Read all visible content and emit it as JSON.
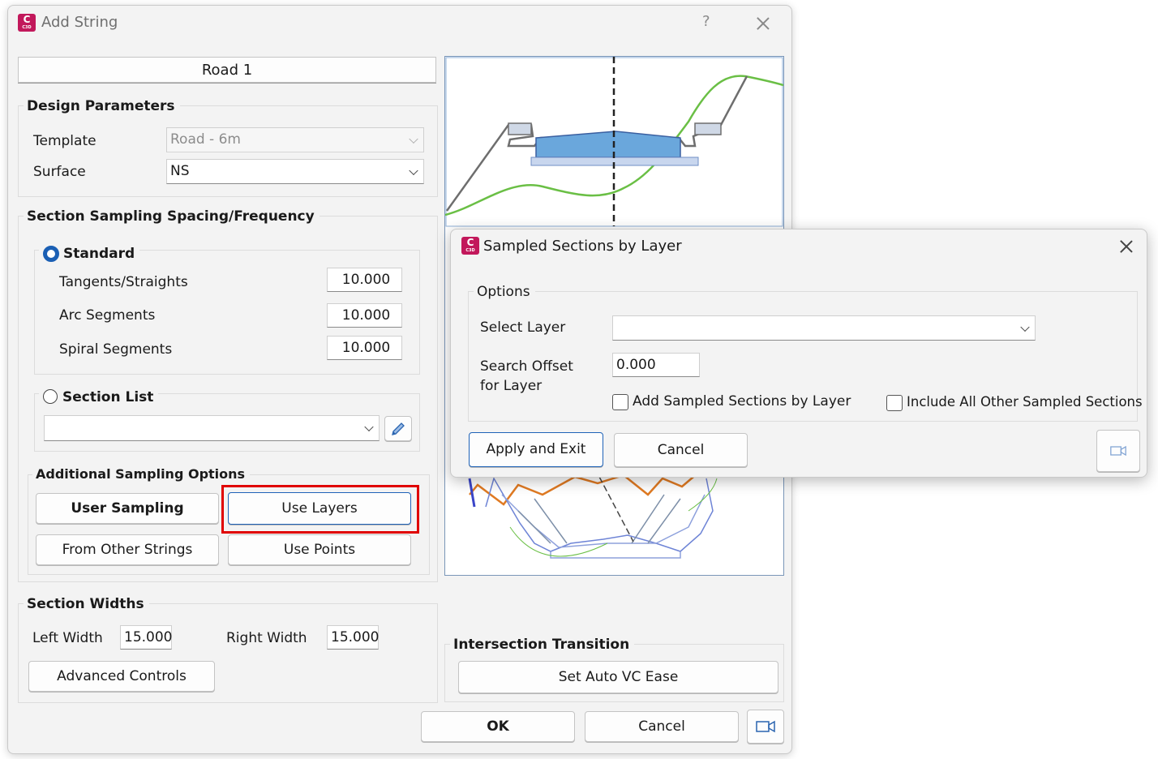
{
  "main_dialog": {
    "title": "Add String",
    "help": "?",
    "road_header": "Road 1",
    "design_parameters": {
      "label": "Design Parameters",
      "template_label": "Template",
      "template_value": "Road - 6m",
      "surface_label": "Surface",
      "surface_value": "NS"
    },
    "sampling": {
      "label": "Section Sampling Spacing/Frequency",
      "standard_label": "Standard",
      "tangents_label": "Tangents/Straights",
      "tangents_value": "10.000",
      "arc_label": "Arc Segments",
      "arc_value": "10.000",
      "spiral_label": "Spiral Segments",
      "spiral_value": "10.000",
      "section_list_label": "Section List",
      "section_list_value": ""
    },
    "additional": {
      "label": "Additional Sampling Options",
      "user_sampling": "User Sampling",
      "use_layers": "Use Layers",
      "from_other_strings": "From Other Strings",
      "use_points": "Use Points"
    },
    "widths": {
      "label": "Section Widths",
      "left_label": "Left Width",
      "left_value": "15.000",
      "right_label": "Right Width",
      "right_value": "15.000",
      "advanced": "Advanced Controls"
    },
    "intersection": {
      "label": "Intersection Transition",
      "set_auto": "Set Auto VC Ease"
    },
    "ok": "OK",
    "cancel": "Cancel"
  },
  "overlay_dialog": {
    "title": "Sampled Sections by Layer",
    "options_label": "Options",
    "select_layer_label": "Select Layer",
    "select_layer_value": "",
    "search_offset_label_1": "Search Offset",
    "search_offset_label_2": "for Layer",
    "search_offset_value": "0.000",
    "add_sampled_label": "Add Sampled Sections by Layer",
    "include_all_label": "Include All Other Sampled Sections",
    "apply_exit": "Apply and Exit",
    "cancel": "Cancel"
  },
  "colors": {
    "highlight": "#e00000",
    "accent": "#1a5fb4",
    "ground_line": "#6abf45",
    "section_line": "#e07a22",
    "app_icon": "#c2185b"
  },
  "icons": [
    "app-icon",
    "help-icon",
    "close-icon",
    "chevron-down-icon",
    "pencil-icon",
    "video-icon"
  ]
}
